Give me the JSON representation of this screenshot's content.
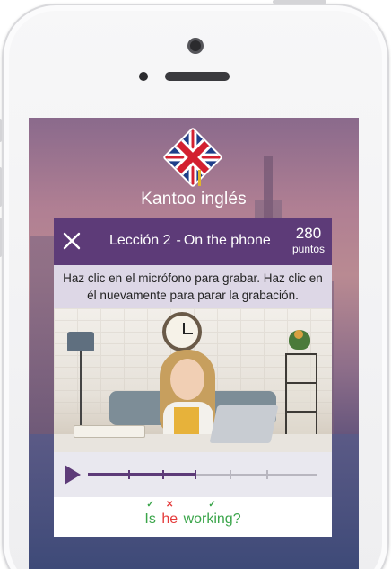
{
  "app": {
    "title": "Kantoo inglés"
  },
  "header": {
    "lesson_label": "Lección 2",
    "separator": "-",
    "lesson_topic": "On the phone",
    "points_value": "280",
    "points_label": "puntos"
  },
  "instruction": {
    "text": "Haz clic en el micrófono para grabar. Haz clic en él nuevamente para parar la grabación."
  },
  "audio": {
    "progress": 0.47,
    "markers": [
      0.18,
      0.33,
      0.47,
      0.62,
      0.78
    ]
  },
  "answer": {
    "words": [
      {
        "text": "Is",
        "correct": true,
        "mark": "✓"
      },
      {
        "text": "he",
        "correct": false,
        "mark": "✕"
      },
      {
        "text": "working?",
        "correct": true,
        "mark": "✓"
      }
    ]
  },
  "colors": {
    "brand_purple": "#5d3b78",
    "correct_green": "#3aa54a",
    "wrong_red": "#e43a3a"
  },
  "icons": {
    "close": "close-icon",
    "play": "play-icon",
    "logo": "union-jack-logo"
  }
}
